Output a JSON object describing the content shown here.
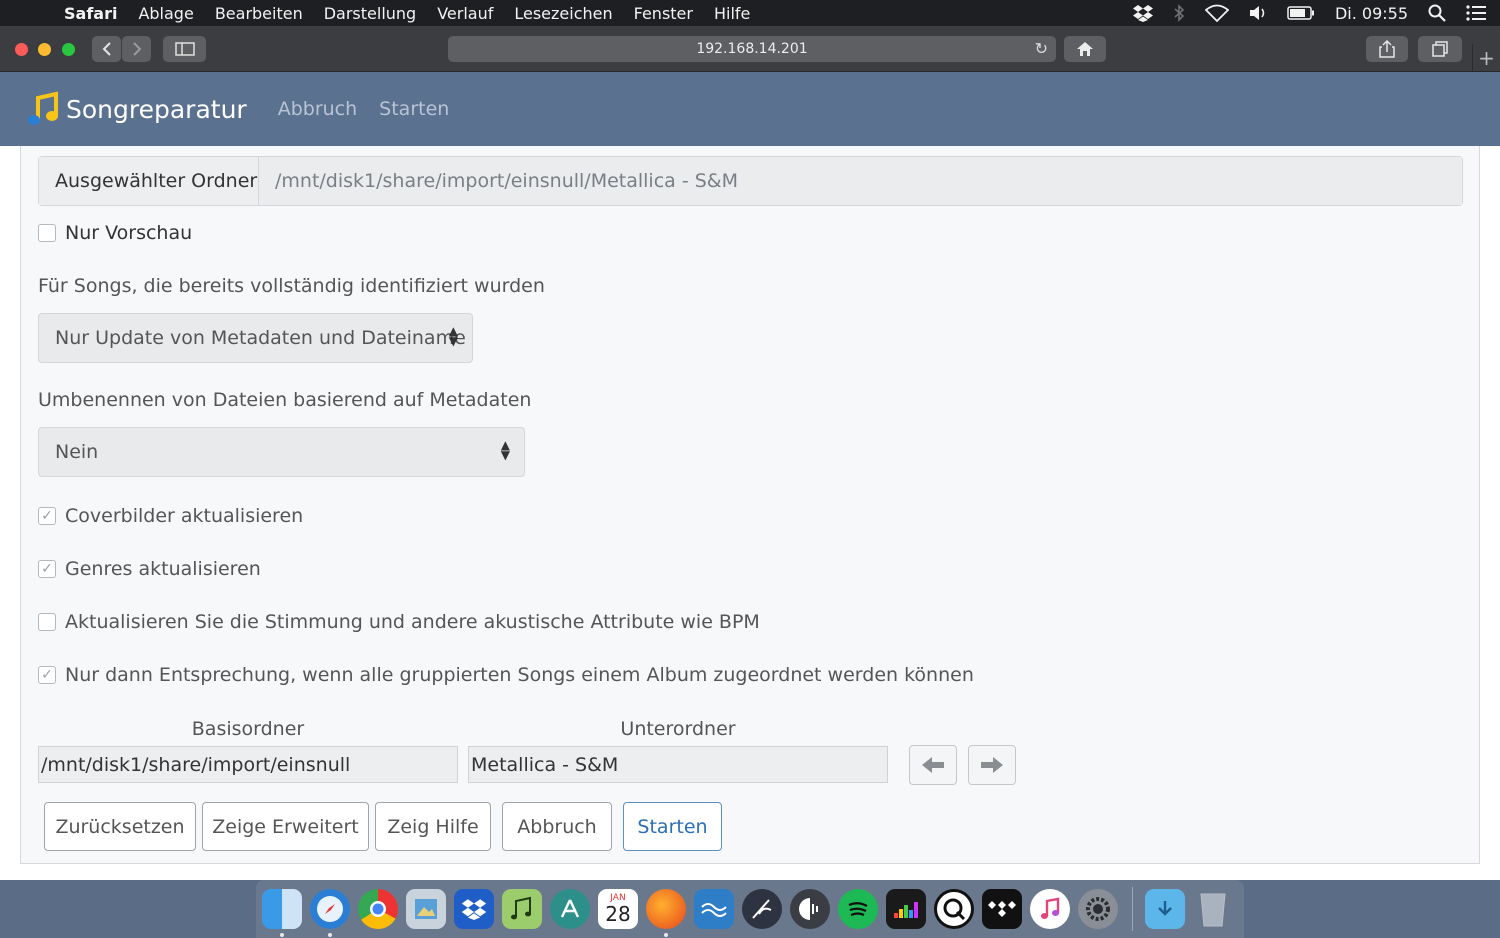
{
  "menubar": {
    "app": "Safari",
    "items": [
      "Ablage",
      "Bearbeiten",
      "Darstellung",
      "Verlauf",
      "Lesezeichen",
      "Fenster",
      "Hilfe"
    ],
    "clock": "Di. 09:55"
  },
  "browser": {
    "url": "192.168.14.201"
  },
  "navbar": {
    "brand": "Songreparatur",
    "links": [
      "Abbruch",
      "Starten"
    ]
  },
  "form": {
    "folder_label": "Ausgewählter Ordner",
    "folder_value": "/mnt/disk1/share/import/einsnull/Metallica - S&M",
    "preview_label": "Nur Vorschau",
    "preview_checked": false,
    "identified_label": "Für Songs, die bereits vollständig identifiziert wurden",
    "identified_select": "Nur Update von Metadaten und Dateiname",
    "rename_label": "Umbenennen von Dateien basierend auf Metadaten",
    "rename_select": "Nein",
    "options": [
      {
        "label": "Coverbilder aktualisieren",
        "checked": true
      },
      {
        "label": "Genres aktualisieren",
        "checked": true
      },
      {
        "label": "Aktualisieren Sie die Stimmung und andere akustische Attribute wie BPM",
        "checked": false
      },
      {
        "label": "Nur dann Entsprechung, wenn alle gruppierten Songs einem Album zugeordnet werden können",
        "checked": true
      }
    ],
    "base_label": "Basisordner",
    "base_value": "/mnt/disk1/share/import/einsnull",
    "sub_label": "Unterordner",
    "sub_value": "Metallica - S&M"
  },
  "buttons": {
    "reset": "Zurücksetzen",
    "advanced": "Zeige Erweitert",
    "help": "Zeig Hilfe",
    "cancel": "Abbruch",
    "start": "Starten"
  },
  "dock": {
    "calendar_month": "JAN",
    "calendar_day": "28"
  }
}
